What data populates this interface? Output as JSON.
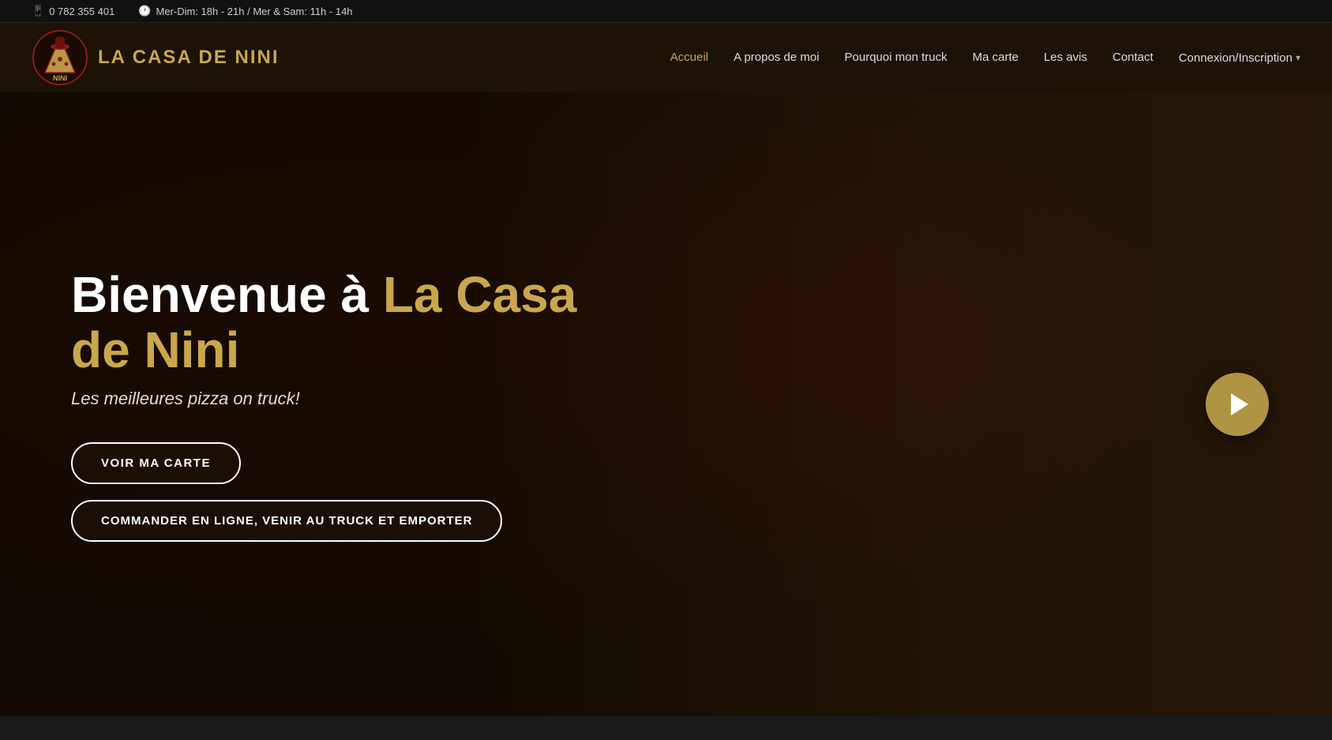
{
  "topbar": {
    "phone_icon": "📱",
    "phone": "0 782 355 401",
    "clock_icon": "🕐",
    "hours": "Mer-Dim: 18h - 21h / Mer & Sam: 11h - 14h"
  },
  "navbar": {
    "brand": "LA CASA DE NINI",
    "links": [
      {
        "label": "Accueil",
        "active": true
      },
      {
        "label": "A propos de moi",
        "active": false
      },
      {
        "label": "Pourquoi mon truck",
        "active": false
      },
      {
        "label": "Ma carte",
        "active": false
      },
      {
        "label": "Les avis",
        "active": false
      },
      {
        "label": "Contact",
        "active": false
      }
    ],
    "connexion": "Connexion/Inscription"
  },
  "hero": {
    "title_part1": "Bienvenue à ",
    "title_part2": "La Casa de Nini",
    "subtitle": "Les meilleures pizza on truck!",
    "btn_voir": "VOIR MA CARTE",
    "btn_commander": "COMMANDER EN LIGNE, VENIR AU TRUCK ET EMPORTER",
    "play_label": "▶"
  }
}
